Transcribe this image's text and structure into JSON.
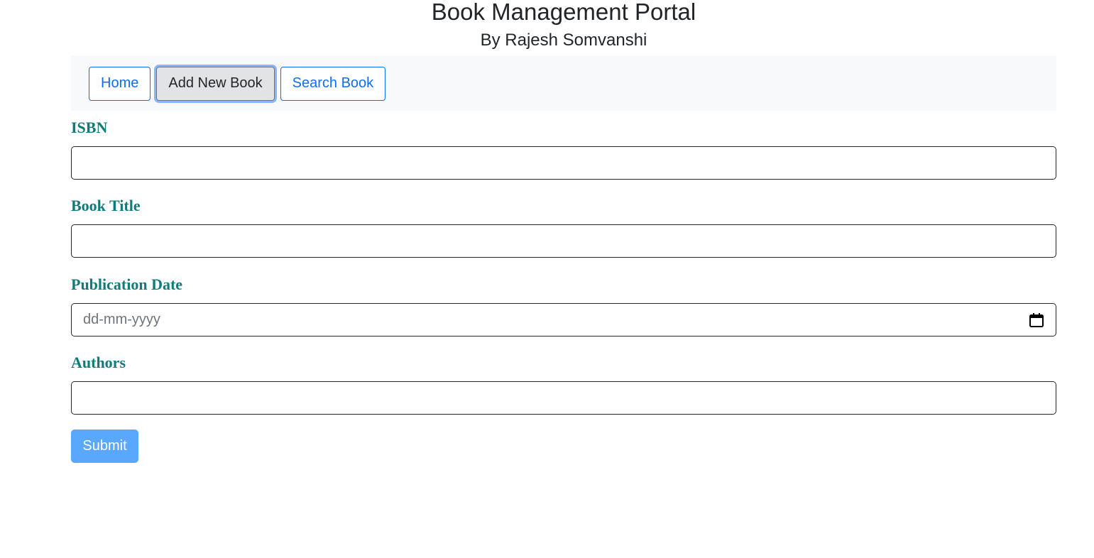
{
  "header": {
    "title": "Book Management Portal",
    "subtitle": "By Rajesh Somvanshi"
  },
  "nav": {
    "items": [
      {
        "label": "Home"
      },
      {
        "label": "Add New Book"
      },
      {
        "label": "Search Book"
      }
    ],
    "active": "Add New Book"
  },
  "form": {
    "fields": [
      {
        "label": "ISBN",
        "value": "",
        "placeholder": ""
      },
      {
        "label": "Book Title",
        "value": "",
        "placeholder": ""
      },
      {
        "label": "Publication Date",
        "value": "",
        "placeholder": "dd-mm-yyyy"
      },
      {
        "label": "Authors",
        "value": "",
        "placeholder": ""
      }
    ],
    "submit_label": "Submit"
  },
  "colors": {
    "label_color": "#117a7a",
    "primary": "#0d6efd",
    "submit_bg": "#5aa8fd",
    "nav_bg": "#f8f9fa"
  },
  "icons": {
    "date_picker": "calendar-icon"
  }
}
